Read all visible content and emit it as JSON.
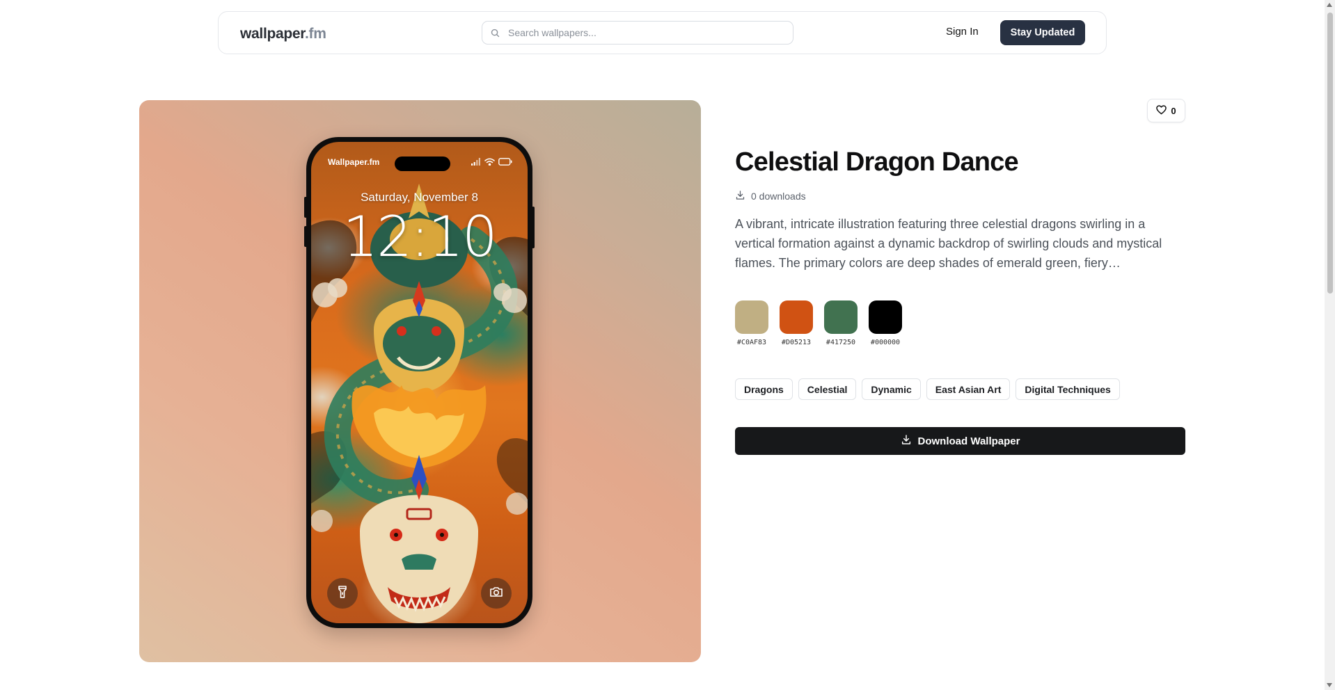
{
  "header": {
    "logo_main": "wallpaper",
    "logo_accent": ".fm",
    "search_placeholder": "Search wallpapers...",
    "signin_label": "Sign In",
    "cta_label": "Stay Updated"
  },
  "preview": {
    "carrier": "Wallpaper.fm",
    "lock_date": "Saturday, November 8",
    "lock_time": "12:10",
    "left_button_icon": "flashlight-icon",
    "right_button_icon": "camera-icon"
  },
  "details": {
    "likes": "0",
    "title": "Celestial Dragon Dance",
    "downloads": "0 downloads",
    "description": "A vibrant, intricate illustration featuring three celestial dragons swirling in a vertical formation against a dynamic backdrop of swirling clouds and mystical flames. The primary colors are deep shades of emerald green, fiery…",
    "colors": [
      {
        "hex": "#C0AF83"
      },
      {
        "hex": "#D05213"
      },
      {
        "hex": "#417250"
      },
      {
        "hex": "#000000"
      }
    ],
    "tags": [
      {
        "label": "Dragons"
      },
      {
        "label": "Celestial"
      },
      {
        "label": "Dynamic"
      },
      {
        "label": "East Asian Art"
      },
      {
        "label": "Digital Techniques"
      }
    ],
    "download_label": "Download Wallpaper"
  }
}
